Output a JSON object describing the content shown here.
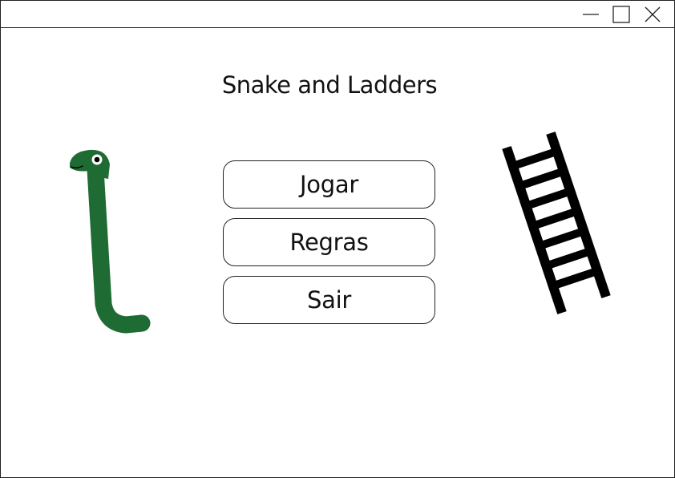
{
  "window": {
    "title_bar": {
      "controls": [
        "minimize-icon",
        "maximize-icon",
        "close-icon"
      ]
    }
  },
  "main": {
    "title": "Snake and Ladders",
    "buttons": {
      "play": "Jogar",
      "rules": "Regras",
      "exit": "Sair"
    }
  },
  "illustrations": {
    "snake": {
      "icon": "snake-icon",
      "color": "#1e6b33"
    },
    "ladder": {
      "icon": "ladder-icon",
      "color": "#000000"
    }
  }
}
